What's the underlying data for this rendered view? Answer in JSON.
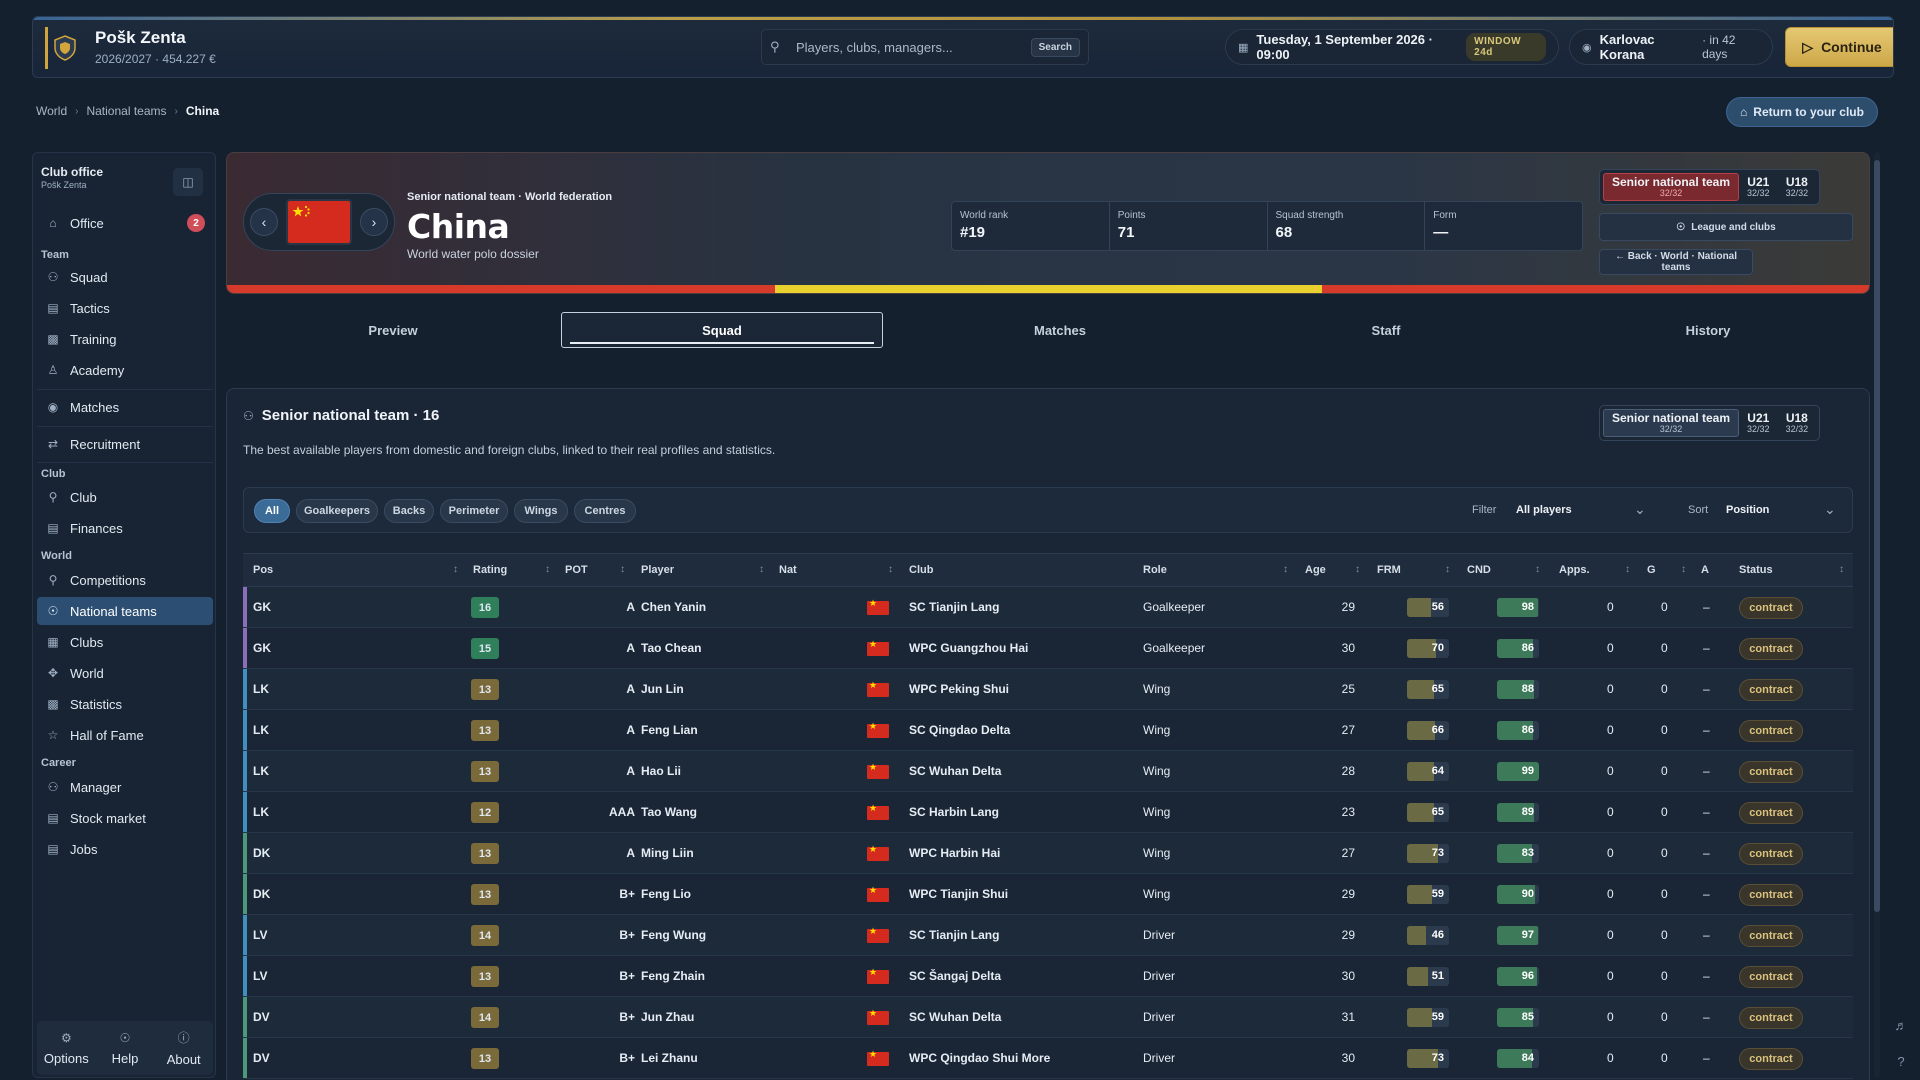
{
  "app": {
    "club_name": "Pošk Zenta",
    "club_sub": "2026/2027 · 454.227 €",
    "search_placeholder": "Players, clubs, managers...",
    "search_button": "Search",
    "date": "Tuesday, 1 September 2026 · 09:00",
    "window_badge": "WINDOW 24d",
    "next_opponent": "Karlovac Korana",
    "next_days": "· in 42 days",
    "continue_label": "Continue"
  },
  "breadcrumb": [
    "World",
    "National teams",
    "China"
  ],
  "return_label": "Return to your club",
  "sidebar": {
    "title": "Club office",
    "subtitle": "Pošk Zenta",
    "office": {
      "label": "Office",
      "icon": "home-icon",
      "badge": "2"
    },
    "groups": [
      {
        "label": "Team",
        "items": [
          {
            "label": "Squad",
            "icon": "users-icon"
          },
          {
            "label": "Tactics",
            "icon": "clipboard-icon"
          },
          {
            "label": "Training",
            "icon": "chart-icon"
          },
          {
            "label": "Academy",
            "icon": "person-icon"
          },
          {
            "label": "Matches",
            "icon": "ball-icon"
          },
          {
            "label": "Recruitment",
            "icon": "arrows-icon"
          }
        ]
      },
      {
        "label": "Club",
        "items": [
          {
            "label": "Club",
            "icon": "trophy-icon"
          },
          {
            "label": "Finances",
            "icon": "wallet-icon"
          }
        ]
      },
      {
        "label": "World",
        "items": [
          {
            "label": "Competitions",
            "icon": "trophy-icon"
          },
          {
            "label": "National teams",
            "icon": "globe-icon",
            "active": true
          },
          {
            "label": "Clubs",
            "icon": "building-icon"
          },
          {
            "label": "World",
            "icon": "compass-icon"
          },
          {
            "label": "Statistics",
            "icon": "chart-icon"
          },
          {
            "label": "Hall of Fame",
            "icon": "star-icon"
          }
        ]
      },
      {
        "label": "Career",
        "items": [
          {
            "label": "Manager",
            "icon": "users-icon"
          },
          {
            "label": "Stock market",
            "icon": "wallet-icon"
          },
          {
            "label": "Jobs",
            "icon": "document-icon"
          }
        ]
      }
    ],
    "footer": [
      {
        "label": "Options",
        "icon": "gear-icon"
      },
      {
        "label": "Help",
        "icon": "help-icon"
      },
      {
        "label": "About",
        "icon": "info-icon"
      }
    ]
  },
  "hero": {
    "kicker": "Senior national team · World federation",
    "title": "China",
    "subtitle": "World water polo dossier",
    "stats": [
      {
        "label": "World rank",
        "value": "#19"
      },
      {
        "label": "Points",
        "value": "71"
      },
      {
        "label": "Squad strength",
        "value": "68"
      },
      {
        "label": "Form",
        "value": "—"
      }
    ],
    "teams": [
      {
        "name": "Senior national team",
        "count": "32/32"
      },
      {
        "name": "U21",
        "count": "32/32"
      },
      {
        "name": "U18",
        "count": "32/32"
      }
    ],
    "league_button": "League and clubs",
    "back_button": "← Back · World · National teams",
    "stripe_colors": [
      "#d63a2a",
      "#e8d02e",
      "#d63a2a"
    ]
  },
  "tabs": [
    "Preview",
    "Squad",
    "Matches",
    "Staff",
    "History"
  ],
  "active_tab": "Squad",
  "squad": {
    "title": "Senior national team · 16",
    "description": "The best available players from domestic and foreign clubs, linked to their real profiles and statistics.",
    "chips": [
      "All",
      "Goalkeepers",
      "Backs",
      "Perimeter",
      "Wings",
      "Centres"
    ],
    "filter_label": "Filter",
    "filter_value": "All players",
    "sort_label": "Sort",
    "sort_value": "Position",
    "columns": [
      "Pos",
      "Rating",
      "POT",
      "Player",
      "Nat",
      "Club",
      "Role",
      "Age",
      "FRM",
      "CND",
      "Apps.",
      "G",
      "A",
      "Status"
    ],
    "rows": [
      {
        "pos": "GK",
        "rating": "16",
        "pot": "A",
        "player": "Chen Yanin",
        "club": "SC Tianjin Lang",
        "role": "Goalkeeper",
        "age": "29",
        "frm": 56,
        "cnd": 98,
        "apps": "0",
        "g": "0",
        "a": "–",
        "status": "contract"
      },
      {
        "pos": "GK",
        "rating": "15",
        "pot": "A",
        "player": "Tao Chean",
        "club": "WPC Guangzhou Hai",
        "role": "Goalkeeper",
        "age": "30",
        "frm": 70,
        "cnd": 86,
        "apps": "0",
        "g": "0",
        "a": "–",
        "status": "contract"
      },
      {
        "pos": "LK",
        "rating": "13",
        "pot": "A",
        "player": "Jun Lin",
        "club": "WPC Peking Shui",
        "role": "Wing",
        "age": "25",
        "frm": 65,
        "cnd": 88,
        "apps": "0",
        "g": "0",
        "a": "–",
        "status": "contract"
      },
      {
        "pos": "LK",
        "rating": "13",
        "pot": "A",
        "player": "Feng Lian",
        "club": "SC Qingdao Delta",
        "role": "Wing",
        "age": "27",
        "frm": 66,
        "cnd": 86,
        "apps": "0",
        "g": "0",
        "a": "–",
        "status": "contract"
      },
      {
        "pos": "LK",
        "rating": "13",
        "pot": "A",
        "player": "Hao Lii",
        "club": "SC Wuhan Delta",
        "role": "Wing",
        "age": "28",
        "frm": 64,
        "cnd": 99,
        "apps": "0",
        "g": "0",
        "a": "–",
        "status": "contract"
      },
      {
        "pos": "LK",
        "rating": "12",
        "pot": "AAA",
        "player": "Tao Wang",
        "club": "SC Harbin Lang",
        "role": "Wing",
        "age": "23",
        "frm": 65,
        "cnd": 89,
        "apps": "0",
        "g": "0",
        "a": "–",
        "status": "contract"
      },
      {
        "pos": "DK",
        "rating": "13",
        "pot": "A",
        "player": "Ming Liin",
        "club": "WPC Harbin Hai",
        "role": "Wing",
        "age": "27",
        "frm": 73,
        "cnd": 83,
        "apps": "0",
        "g": "0",
        "a": "–",
        "status": "contract"
      },
      {
        "pos": "DK",
        "rating": "13",
        "pot": "B+",
        "player": "Feng Lio",
        "club": "WPC Tianjin Shui",
        "role": "Wing",
        "age": "29",
        "frm": 59,
        "cnd": 90,
        "apps": "0",
        "g": "0",
        "a": "–",
        "status": "contract"
      },
      {
        "pos": "LV",
        "rating": "14",
        "pot": "B+",
        "player": "Feng Wung",
        "club": "SC Tianjin Lang",
        "role": "Driver",
        "age": "29",
        "frm": 46,
        "cnd": 97,
        "apps": "0",
        "g": "0",
        "a": "–",
        "status": "contract"
      },
      {
        "pos": "LV",
        "rating": "13",
        "pot": "B+",
        "player": "Feng Zhain",
        "club": "SC Šangaj Delta",
        "role": "Driver",
        "age": "30",
        "frm": 51,
        "cnd": 96,
        "apps": "0",
        "g": "0",
        "a": "–",
        "status": "contract"
      },
      {
        "pos": "DV",
        "rating": "14",
        "pot": "B+",
        "player": "Jun Zhau",
        "club": "SC Wuhan Delta",
        "role": "Driver",
        "age": "31",
        "frm": 59,
        "cnd": 85,
        "apps": "0",
        "g": "0",
        "a": "–",
        "status": "contract"
      },
      {
        "pos": "DV",
        "rating": "13",
        "pot": "B+",
        "player": "Lei Zhanu",
        "club": "WPC Qingdao Shui More",
        "role": "Driver",
        "age": "30",
        "frm": 73,
        "cnd": 84,
        "apps": "0",
        "g": "0",
        "a": "–",
        "status": "contract"
      }
    ]
  },
  "colors": {
    "accent_blue": "#3b6b97",
    "gold": "#d1a53b",
    "gk_accent": "#8a6fb8",
    "lk_accent": "#3f8fbf",
    "dk_accent": "#4a9a7a",
    "lv_accent": "#3f8fbf",
    "dv_accent": "#4a9a7a",
    "rating_green": "#2f7f5a",
    "rating_amber": "#7a6a3a",
    "frm_fill": "#6a6a44",
    "cnd_fill": "#3d7a5a"
  }
}
